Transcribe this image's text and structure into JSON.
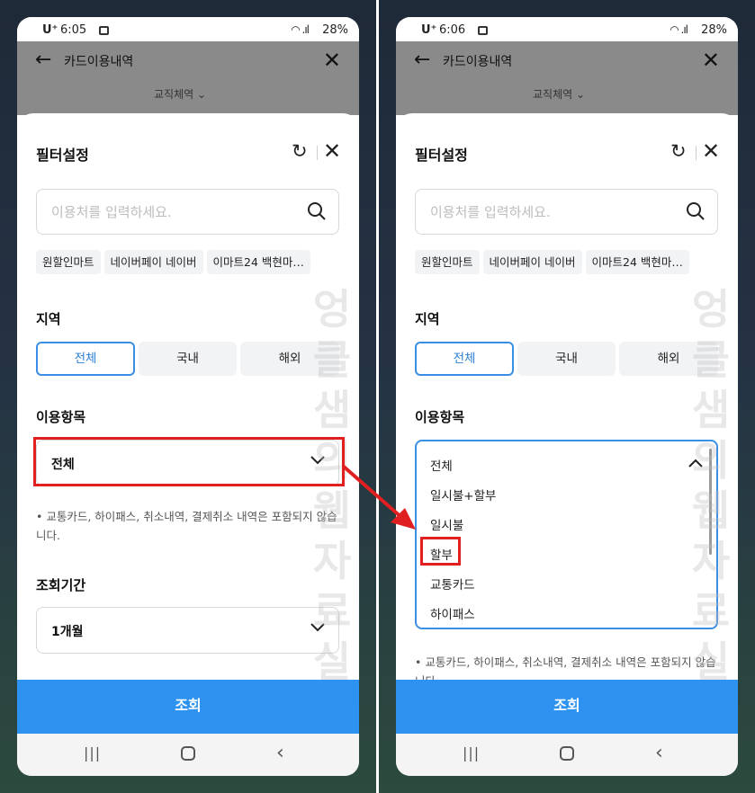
{
  "left": {
    "status": {
      "carrier": "U⁺",
      "time": "6:05",
      "battery": "28%"
    },
    "appbar": {
      "title": "카드이용내역",
      "subtab": "교직체역 ⌄"
    },
    "sheet": {
      "title": "필터설정",
      "search_placeholder": "이용처를 입력하세요.",
      "chips": [
        "원할인마트",
        "네이버페이 네이버",
        "이마트24 백현마…"
      ],
      "region_label": "지역",
      "region_options": [
        "전체",
        "국내",
        "해외"
      ],
      "region_selected": "전체",
      "category_label": "이용항목",
      "category_value": "전체",
      "note": "• 교통카드, 하이패스, 취소내역, 결제취소 내역은 포함되지 않습니다.",
      "period_label": "조회기간",
      "period_value": "1개월"
    },
    "cta": "조회"
  },
  "right": {
    "status": {
      "carrier": "U⁺",
      "time": "6:06",
      "battery": "28%"
    },
    "appbar": {
      "title": "카드이용내역",
      "subtab": "교직체역 ⌄"
    },
    "sheet": {
      "title": "필터설정",
      "search_placeholder": "이용처를 입력하세요.",
      "chips": [
        "원할인마트",
        "네이버페이 네이버",
        "이마트24 백현마…"
      ],
      "region_label": "지역",
      "region_options": [
        "전체",
        "국내",
        "해외"
      ],
      "region_selected": "전체",
      "category_label": "이용항목",
      "category_options": [
        "전체",
        "일시불+할부",
        "일시불",
        "할부",
        "교통카드",
        "하이패스"
      ],
      "highlighted_option": "할부",
      "note": "• 교통카드, 하이패스, 취소내역, 결제취소 내역은 포함되지 않습니다."
    },
    "cta": "조회"
  },
  "watermark": [
    "엉",
    "클",
    "샘",
    "의",
    "웹",
    "자",
    "료",
    "실"
  ],
  "colors": {
    "accent": "#2e93f0",
    "selected_border": "#3a8ee6",
    "annotation_red": "#e02020"
  },
  "icons": [
    "back-arrow-icon",
    "close-icon",
    "refresh-icon",
    "search-icon",
    "chevron-down-icon",
    "chevron-up-icon",
    "recent-apps-icon",
    "home-icon",
    "nav-back-icon"
  ]
}
